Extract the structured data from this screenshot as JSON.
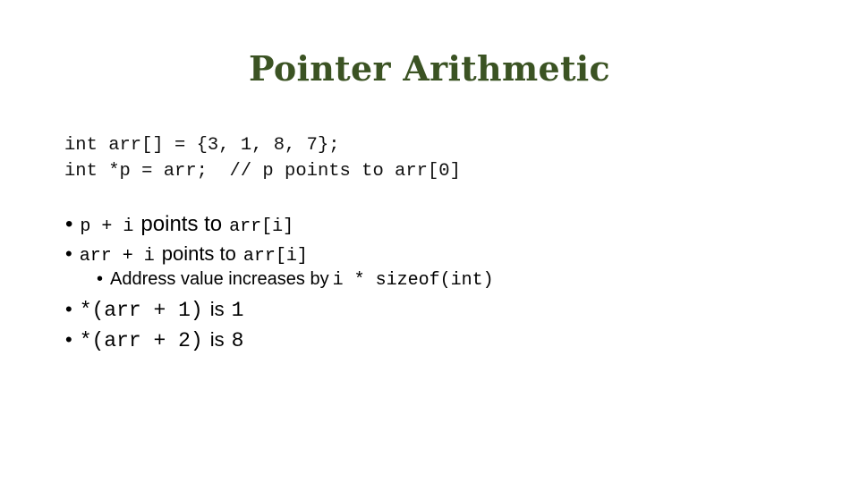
{
  "slide": {
    "title": "Pointer Arithmetic",
    "code_lines": [
      "int arr[] = {3, 1, 8, 7};",
      "int *p = arr;  // p points to arr[0]"
    ],
    "bullets": [
      {
        "code": "p + i",
        "text": "points to",
        "code2": "arr[i]"
      },
      {
        "code": "arr + i",
        "text": "points to",
        "code2": "arr[i]"
      },
      {
        "text": "Address value increases by",
        "code": "i * sizeof(int)"
      },
      {
        "code": "*(arr + 1)",
        "text": "is",
        "code2": "1"
      },
      {
        "code": "*(arr + 2)",
        "text": "is",
        "code2": "8"
      }
    ],
    "bullet_glyph": "•"
  }
}
